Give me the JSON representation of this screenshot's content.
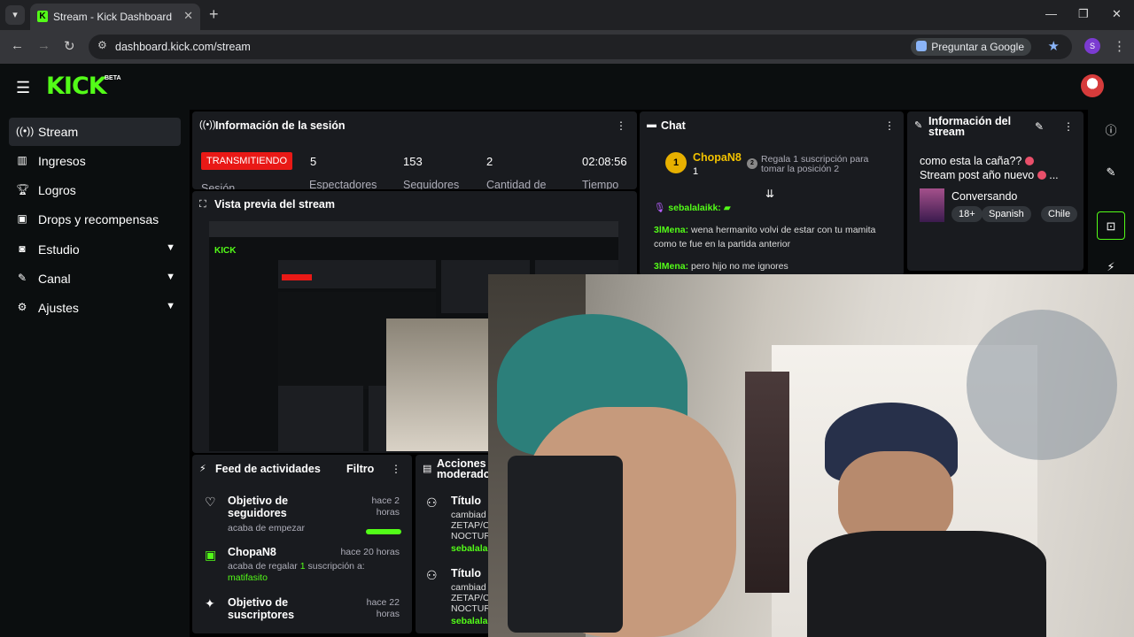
{
  "browser": {
    "tab_title": "Stream - Kick Dashboard",
    "url": "dashboard.kick.com/stream",
    "ask_google": "Preguntar a Google",
    "profile_initial": "S"
  },
  "brand": {
    "logo": "KICK",
    "badge": "BETA"
  },
  "sidebar": {
    "items": [
      {
        "label": "Stream",
        "icon": "broadcast-icon",
        "active": true
      },
      {
        "label": "Ingresos",
        "icon": "chart-icon"
      },
      {
        "label": "Logros",
        "icon": "trophy-icon"
      },
      {
        "label": "Drops y recompensas",
        "icon": "gift-icon"
      },
      {
        "label": "Estudio",
        "icon": "studio-icon",
        "expandable": true
      },
      {
        "label": "Canal",
        "icon": "channel-icon",
        "expandable": true
      },
      {
        "label": "Ajustes",
        "icon": "settings-icon",
        "expandable": true
      }
    ]
  },
  "session": {
    "title": "Información de la sesión",
    "live_label": "TRANSMITIENDO",
    "clipped_label": "Sesión",
    "stats": [
      {
        "value": "5",
        "label": "Espectadores"
      },
      {
        "value": "153",
        "label": "Seguidores"
      },
      {
        "value": "2",
        "label": "Cantidad de"
      },
      {
        "value": "02:08:56",
        "label": "Tiempo"
      }
    ]
  },
  "preview": {
    "title": "Vista previa del stream"
  },
  "chat": {
    "title": "Chat",
    "top_gifter": {
      "rank": "1",
      "name": "ChopaN8",
      "count": "1"
    },
    "next_rank": "2",
    "gift_prompt": "Regala 1 suscripción para tomar la posición 2",
    "messages": [
      {
        "user": "sebalalaikk:",
        "text": ""
      },
      {
        "user": "3lMena:",
        "text": "wena hermanito volvi de estar con tu mamita como te fue en la partida anterior"
      },
      {
        "user": "3lMena:",
        "text": "pero hijo no me ignores"
      }
    ]
  },
  "stream_info": {
    "title_line1": "Información del",
    "title_line2": "stream",
    "stream_title_1": "como esta la caña??",
    "stream_title_2": "Stream post año nuevo",
    "ellipsis": "...",
    "category": "Conversando",
    "tags": [
      "18+",
      "Spanish",
      "Chile"
    ]
  },
  "feed": {
    "title": "Feed de actividades",
    "filter": "Filtro",
    "items": [
      {
        "title_1": "Objetivo de",
        "title_2": "seguidores",
        "sub": "acaba de empezar",
        "time_1": "hace 2",
        "time_2": "horas",
        "progress": 1.0
      },
      {
        "title_1": "ChopaN8",
        "sub_1": "acaba de regalar",
        "sub_count": "1",
        "sub_2": "suscripción a:",
        "sub_target": "matifasito",
        "time_1": "hace 20 horas"
      },
      {
        "title_1": "Objetivo de",
        "title_2": "suscriptores",
        "time_1": "hace 22",
        "time_2": "horas"
      }
    ]
  },
  "moderation": {
    "title_1": "Acciones",
    "title_2": "moderado",
    "items": [
      {
        "label": "Título",
        "line_1": "cambiad",
        "line_2": "ZETAP/C",
        "line_3": "NOCTUR",
        "user": "sebalalai"
      },
      {
        "label": "Título",
        "line_1": "cambiad",
        "line_2": "ZETAP/C",
        "line_3": "NOCTUR",
        "user": "sebalalai"
      }
    ]
  },
  "colors": {
    "accent": "#53fc18",
    "live": "#e91916",
    "panel": "#191b1f",
    "bg": "#0b0e0f"
  }
}
